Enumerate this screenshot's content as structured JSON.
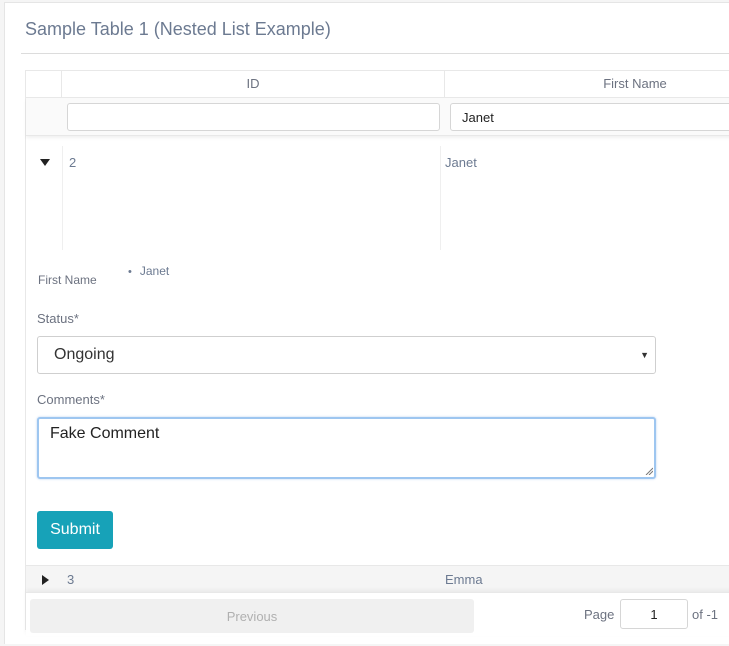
{
  "card": {
    "title": "Sample Table 1 (Nested List Example)"
  },
  "table": {
    "columns": [
      "ID",
      "First Name"
    ],
    "filters": {
      "id": "",
      "first_name": "Janet"
    },
    "rows": [
      {
        "id": "2",
        "first_name": "Janet",
        "expanded": true,
        "detail": {
          "first_name_label": "First Name",
          "first_name_items": [
            "Janet"
          ],
          "status_label": "Status*",
          "status_value": "Ongoing",
          "comments_label": "Comments*",
          "comments_value": "Fake Comment",
          "submit_label": "Submit"
        }
      },
      {
        "id": "3",
        "first_name": "Emma",
        "expanded": false
      }
    ]
  },
  "pagination": {
    "previous_label": "Previous",
    "page_label": "Page",
    "page_value": "1",
    "of_label": "of -1"
  },
  "colors": {
    "accent": "#17a2b8",
    "focus_border": "#9ec6f0",
    "muted_text": "#6c7a91"
  },
  "icons": {
    "expand_down": "caret-down-icon",
    "expand_right": "caret-right-icon",
    "select_arrow": "dropdown-arrow-icon"
  }
}
